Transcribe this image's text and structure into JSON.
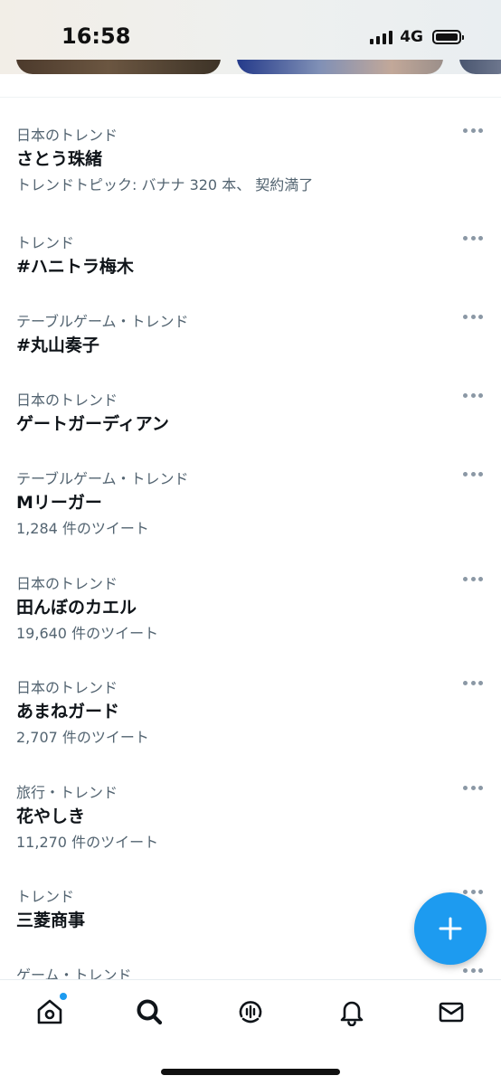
{
  "status_bar": {
    "time": "16:58",
    "network": "4G",
    "icons": [
      "signal-icon",
      "battery-icon"
    ]
  },
  "carousel": {
    "thumbnails": [
      "image",
      "image",
      "image"
    ]
  },
  "trends": [
    {
      "meta": "日本のトレンド",
      "name": "さとう珠緒",
      "sub": "トレンドトピック: バナナ 320 本、 契約満了"
    },
    {
      "meta": "トレンド",
      "name": "#ハニトラ梅木",
      "sub": ""
    },
    {
      "meta": "テーブルゲーム・トレンド",
      "name": "#丸山奏子",
      "sub": ""
    },
    {
      "meta": "日本のトレンド",
      "name": "ゲートガーディアン",
      "sub": ""
    },
    {
      "meta": "テーブルゲーム・トレンド",
      "name": "Mリーガー",
      "sub": "1,284 件のツイート"
    },
    {
      "meta": "日本のトレンド",
      "name": "田んぼのカエル",
      "sub": "19,640 件のツイート"
    },
    {
      "meta": "日本のトレンド",
      "name": "あまねガード",
      "sub": "2,707 件のツイート"
    },
    {
      "meta": "旅行・トレンド",
      "name": "花やしき",
      "sub": "11,270 件のツイート"
    },
    {
      "meta": "トレンド",
      "name": "三菱商事",
      "sub": ""
    },
    {
      "meta": "ゲーム・トレンド",
      "name": "",
      "sub": ""
    }
  ],
  "fab": {
    "icon": "plus-icon"
  },
  "tab_bar": {
    "items": [
      {
        "name": "home",
        "icon": "home-icon",
        "has_notification_dot": true
      },
      {
        "name": "explore",
        "icon": "search-icon",
        "active": true
      },
      {
        "name": "spaces",
        "icon": "spaces-icon"
      },
      {
        "name": "notifications",
        "icon": "bell-icon"
      },
      {
        "name": "messages",
        "icon": "mail-icon"
      }
    ]
  },
  "colors": {
    "accent": "#1d9bf0",
    "text_primary": "#0f1419",
    "text_secondary": "#536471"
  }
}
